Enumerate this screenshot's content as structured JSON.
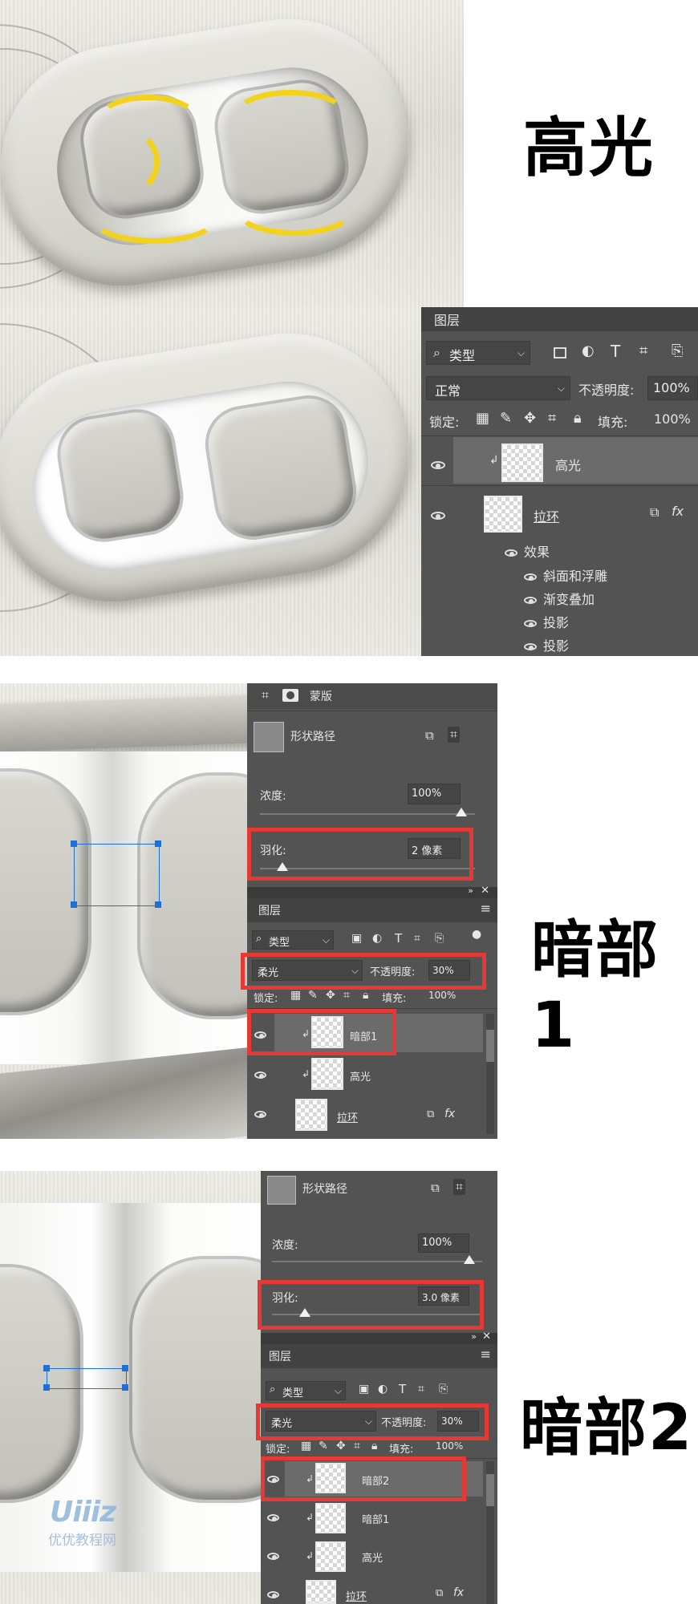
{
  "labels": {
    "highlight": "高光",
    "dark1": "暗部1",
    "dark2": "暗部2"
  },
  "panel1": {
    "title": "图层",
    "filter_kind": "类型",
    "blend_mode": "正常",
    "opacity_label": "不透明度:",
    "opacity_value": "100%",
    "lock_label": "锁定:",
    "fill_label": "填充:",
    "fill_value": "100%",
    "layers": [
      {
        "name": "高光"
      },
      {
        "name": "拉环"
      }
    ],
    "effects_label": "效果",
    "effects": [
      "斜面和浮雕",
      "渐变叠加",
      "投影",
      "投影"
    ],
    "fx": "fx"
  },
  "panel2": {
    "mask_label": "蒙版",
    "shape_path": "形状路径",
    "density_label": "浓度:",
    "density_value": "100%",
    "feather_label": "羽化:",
    "feather_value": "2 像素",
    "feather_fraction": 0.08,
    "layers_title": "图层",
    "filter_kind": "类型",
    "blend_mode": "柔光",
    "opacity_label": "不透明度:",
    "opacity_value": "30%",
    "lock_label": "锁定:",
    "fill_label": "填充:",
    "fill_value": "100%",
    "layers": [
      {
        "name": "暗部1"
      },
      {
        "name": "高光"
      },
      {
        "name": "拉环"
      }
    ],
    "fx": "fx"
  },
  "panel3": {
    "shape_path": "形状路径",
    "density_label": "浓度:",
    "density_value": "100%",
    "feather_label": "羽化:",
    "feather_value": "3.0 像素",
    "feather_fraction": 0.15,
    "layers_title": "图层",
    "filter_kind": "类型",
    "blend_mode": "柔光",
    "opacity_label": "不透明度:",
    "opacity_value": "30%",
    "lock_label": "锁定:",
    "fill_label": "填充:",
    "fill_value": "100%",
    "layers": [
      {
        "name": "暗部2"
      },
      {
        "name": "暗部1"
      },
      {
        "name": "高光"
      },
      {
        "name": "拉环"
      }
    ],
    "fx": "fx"
  },
  "watermark": {
    "logo": "Uiiiz",
    "site": "优优教程网"
  },
  "colors": {
    "panel_bg": "#535353",
    "highlight_stroke": "#f3d21c",
    "annotation_red": "#e53935",
    "selection_blue": "#1e6fd6"
  }
}
